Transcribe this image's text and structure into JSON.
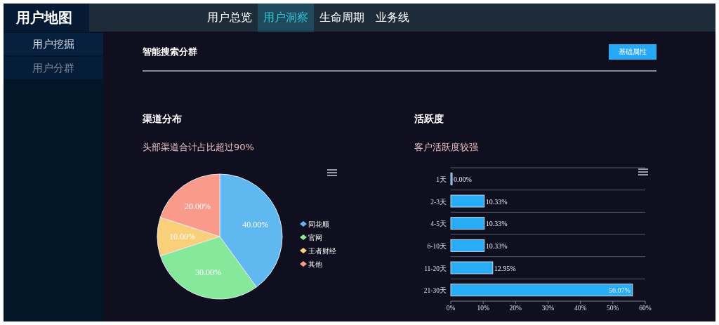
{
  "header": {
    "logo": "用户地图",
    "tabs": [
      {
        "label": "用户总览",
        "selected": false
      },
      {
        "label": "用户洞察",
        "selected": true
      },
      {
        "label": "生命周期",
        "selected": false
      },
      {
        "label": "业务线",
        "selected": false
      }
    ]
  },
  "sidebar": {
    "items": [
      {
        "label": "用户挖掘",
        "selected": true
      },
      {
        "label": "用户分群",
        "selected": false
      }
    ]
  },
  "toolbar": {
    "title": "智能搜索分群",
    "button": "基础属性"
  },
  "panels": [
    {
      "title": "渠道分布",
      "subtitle": "头部渠道合计占比超过90%",
      "chart_data": {
        "type": "pie",
        "categories": [
          "同花顺",
          "官网",
          "王者财经",
          "其他"
        ],
        "values": [
          40,
          30,
          10,
          20
        ],
        "legend": true,
        "value_labels": [
          "40.00%",
          "30.00%",
          "10.00%",
          "20.00%"
        ]
      }
    },
    {
      "title": "活跃度",
      "subtitle": "客户活跃度较强",
      "chart_data": {
        "type": "bar",
        "orientation": "horizontal",
        "categories": [
          "1天",
          "2-3天",
          "4-5天",
          "6-10天",
          "11-20天",
          "21-30天"
        ],
        "values": [
          0,
          10.33,
          10.33,
          10.33,
          12.95,
          56.07
        ],
        "value_labels": [
          "0.00%",
          "10.33%",
          "10.33%",
          "10.33%",
          "12.95%",
          "56.07%"
        ],
        "xlim": [
          0,
          60
        ],
        "xticks": [
          {
            "value": 0,
            "label": "0%"
          },
          {
            "value": 10,
            "label": "10%"
          },
          {
            "value": 20,
            "label": "20%"
          },
          {
            "value": 30,
            "label": "30%"
          },
          {
            "value": 40,
            "label": "40%"
          },
          {
            "value": 50,
            "label": "50%"
          },
          {
            "value": 60,
            "label": "60%"
          }
        ]
      }
    }
  ]
}
